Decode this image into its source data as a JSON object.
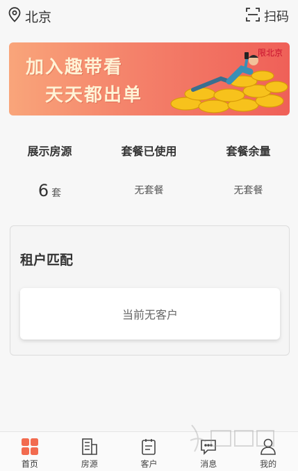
{
  "topbar": {
    "location_icon": "location-pin-icon",
    "city": "北京",
    "scan_icon": "scan-icon",
    "scan_label": "扫码"
  },
  "banner": {
    "line1": "加入趣带看",
    "line2": "天天都出单",
    "tag": "限北京",
    "colors": {
      "start": "#f9a57a",
      "end": "#ef6058"
    }
  },
  "stats": [
    {
      "label": "展示房源",
      "value_num": "6",
      "value_unit": "套"
    },
    {
      "label": "套餐已使用",
      "value_text": "无套餐"
    },
    {
      "label": "套餐余量",
      "value_text": "无套餐"
    }
  ],
  "tenant_match": {
    "title": "租户匹配",
    "empty_text": "当前无客户"
  },
  "tabbar": {
    "items": [
      {
        "label": "首页",
        "icon": "home-grid-icon",
        "active": true
      },
      {
        "label": "房源",
        "icon": "building-icon",
        "active": false
      },
      {
        "label": "客户",
        "icon": "clipboard-icon",
        "active": false
      },
      {
        "label": "消息",
        "icon": "chat-icon",
        "active": false
      },
      {
        "label": "我的",
        "icon": "user-icon",
        "active": false
      }
    ],
    "accent": "#f26b4f"
  }
}
